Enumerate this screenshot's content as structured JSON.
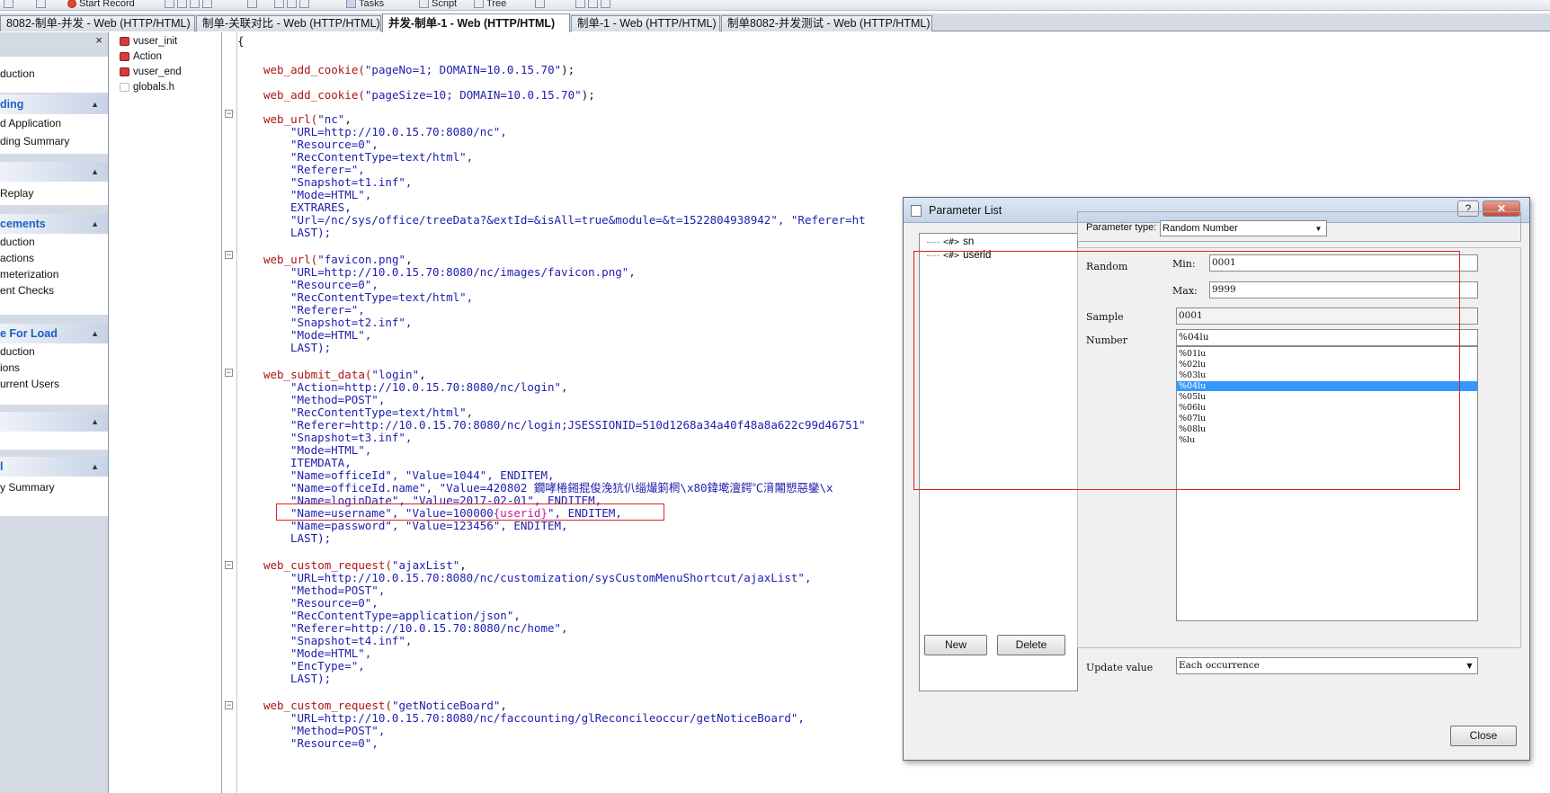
{
  "toolbar": {
    "start_record": "Start Record",
    "script": "Script",
    "tree": "Tree",
    "tasks": "Tasks"
  },
  "tabs": [
    {
      "label": "8082-制单-并发 - Web (HTTP/HTML)"
    },
    {
      "label": "制单-关联对比 - Web (HTTP/HTML)"
    },
    {
      "label": "并发-制单-1 - Web (HTTP/HTML)"
    },
    {
      "label": "制单-1 - Web (HTTP/HTML)"
    },
    {
      "label": "制单8082-并发测试 - Web (HTTP/HTML)"
    }
  ],
  "taskpane": {
    "close": "×",
    "top_item": "duction",
    "sections": [
      {
        "title": "ding",
        "items": [
          "d Application",
          "ding Summary"
        ]
      },
      {
        "title": "",
        "items": [
          " Replay"
        ]
      },
      {
        "title": "cements",
        "items": [
          "duction",
          "actions",
          "meterization",
          "ent Checks"
        ]
      },
      {
        "title": "e For Load",
        "items": [
          "duction",
          "ions",
          "urrent Users"
        ]
      },
      {
        "title": "",
        "items": [
          ""
        ]
      },
      {
        "title": "l",
        "items": [
          "y Summary"
        ]
      }
    ]
  },
  "script_files": [
    "vuser_init",
    "Action",
    "vuser_end",
    "globals.h"
  ],
  "code": {
    "l0": "{",
    "c1a": "web_add_cookie(",
    "c1b": "\"pageNo=1; DOMAIN=10.0.15.70\"",
    "c1c": ");",
    "c2a": "web_add_cookie(",
    "c2b": "\"pageSize=10; DOMAIN=10.0.15.70\"",
    "c2c": ");",
    "u1a": "web_url(",
    "u1b": "\"nc\"",
    "u1c": ",",
    "u1_1": "\"URL=http://10.0.15.70:8080/nc\",",
    "u1_2": "\"Resource=0\",",
    "u1_3": "\"RecContentType=text/html\",",
    "u1_4": "\"Referer=\",",
    "u1_5": "\"Snapshot=t1.inf\",",
    "u1_6": "\"Mode=HTML\",",
    "u1_7": "EXTRARES,",
    "u1_8": "\"Url=/nc/sys/office/treeData?&extId=&isAll=true&module=&t=1522804938942\", \"Referer=ht",
    "u1_9": "LAST);",
    "u2a": "web_url(",
    "u2b": "\"favicon.png\"",
    "u2c": ",",
    "u2_1": "\"URL=http://10.0.15.70:8080/nc/images/favicon.png\",",
    "u2_2": "\"Resource=0\",",
    "u2_3": "\"RecContentType=text/html\",",
    "u2_4": "\"Referer=\",",
    "u2_5": "\"Snapshot=t2.inf\",",
    "u2_6": "\"Mode=HTML\",",
    "u2_7": "LAST);",
    "s1a": "web_submit_data(",
    "s1b": "\"login\"",
    "s1c": ",",
    "s1_1": "\"Action=http://10.0.15.70:8080/nc/login\",",
    "s1_2": "\"Method=POST\",",
    "s1_3": "\"RecContentType=text/html\",",
    "s1_4": "\"Referer=http://10.0.15.70:8080/nc/login;JSESSIONID=510d1268a34a40f48a8a622c99d46751\"",
    "s1_5": "\"Snapshot=t3.inf\",",
    "s1_6": "\"Mode=HTML\",",
    "s1_7": "ITEMDATA,",
    "s1_8": "\"Name=officeId\", \"Value=1044\", ENDITEM,",
    "s1_9": "\"Name=officeId.name\", \"Value=420802 鐗哮棬鎺掍俊浼犺仈缁熶箣棢\\x80鍏墘澶鍔℃湇闂愬惡鑾\\x",
    "s1_10": "\"Name=loginDate\", \"Value=2017-02-01\", ENDITEM,",
    "s1_11a": "\"Name=username\", \"Value=100000",
    "s1_11b": "{userid}",
    "s1_11c": "\", ENDITEM,",
    "s1_12": "\"Name=password\", \"Value=123456\", ENDITEM,",
    "s1_13": "LAST);",
    "r1a": "web_custom_request(",
    "r1b": "\"ajaxList\"",
    "r1c": ",",
    "r1_1": "\"URL=http://10.0.15.70:8080/nc/customization/sysCustomMenuShortcut/ajaxList\",",
    "r1_2": "\"Method=POST\",",
    "r1_3": "\"Resource=0\",",
    "r1_4": "\"RecContentType=application/json\",",
    "r1_5": "\"Referer=http://10.0.15.70:8080/nc/home\",",
    "r1_6": "\"Snapshot=t4.inf\",",
    "r1_7": "\"Mode=HTML\",",
    "r1_8": "\"EncType=\",",
    "r1_9": "LAST);",
    "r2a": "web_custom_request(",
    "r2b": "\"getNoticeBoard\"",
    "r2c": ",",
    "r2_1": "\"URL=http://10.0.15.70:8080/nc/faccounting/glReconcileoccur/getNoticeBoard\",",
    "r2_2": "\"Method=POST\",",
    "r2_3": "\"Resource=0\","
  },
  "dialog": {
    "title": "Parameter List",
    "help": "?",
    "close_x": "✕",
    "params": [
      "sn",
      "userid"
    ],
    "param_prefix": "<#>",
    "new_button": "New",
    "delete_button": "Delete",
    "param_type_label": "Parameter type:",
    "param_type_value": "Random Number",
    "random_label": "Random",
    "min_label": "Min:",
    "min_value": "0001",
    "max_label": "Max:",
    "max_value": "9999",
    "sample_label": "Sample",
    "sample_value": "0001",
    "number_label": "Number",
    "number_value": "%04lu",
    "formats": [
      "%01lu",
      "%02lu",
      "%03lu",
      "%04lu",
      "%05lu",
      "%06lu",
      "%07lu",
      "%08lu",
      "%lu"
    ],
    "selected_format": "%04lu",
    "update_label": "Update value",
    "update_value": "Each occurrence",
    "close_button": "Close"
  },
  "colors": {
    "function": "#b01414",
    "string": "#2020b0",
    "parameter": "#c020a0",
    "annotation": "#e02020",
    "selection": "#3399ff"
  }
}
